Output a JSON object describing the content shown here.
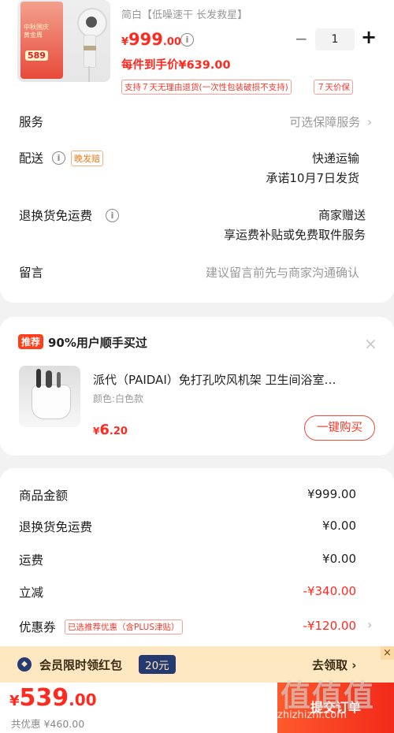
{
  "product": {
    "title": "简白【低噪速干 长发救星】",
    "price_symbol": "¥",
    "price_int": "999",
    "price_dec": ".00",
    "info_glyph": "i",
    "unit_price": "每件到手价¥639.00",
    "tag_return": "支持７天无理由退货(一次性包装破损不支持)",
    "tag_price": "７天价保",
    "poster_lines": [
      "中秋国庆",
      "黄金周"
    ],
    "poster_price": "589",
    "minus_glyph": "−",
    "quantity": "1",
    "plus_glyph": "+"
  },
  "rows": {
    "service": {
      "label": "服务",
      "value": "可选保障服务"
    },
    "delivery": {
      "label": "配送",
      "tag": "晚发赔",
      "line1": "快递运输",
      "line2": "承诺10月7日发货"
    },
    "return_fee": {
      "label": "退换货免运费",
      "line1": "商家赠送",
      "line2": "享运费补贴或免费取件服务"
    },
    "note": {
      "label": "留言",
      "placeholder": "建议留言前先与商家沟通确认"
    }
  },
  "recommend": {
    "badge": "推荐",
    "title": "90%用户顺手买过",
    "item_title": "派代（PAIDAI）免打孔吹风机架 卫生间浴室…",
    "item_spec": "颜色:白色款",
    "item_price_symbol": "¥",
    "item_price_int": "6",
    "item_price_dec": ".20",
    "button": "一键购买",
    "close_glyph": "×"
  },
  "summary": {
    "goods_label": "商品金额",
    "goods_value": "¥999.00",
    "return_label": "退换货免运费",
    "return_value": "¥0.00",
    "ship_label": "运费",
    "ship_value": "¥0.00",
    "discount_label": "立减",
    "discount_value": "-¥340.00",
    "coupon_label": "优惠券",
    "coupon_tag": "已选推荐优惠（含PLUS津贴）",
    "coupon_value": "-¥120.00"
  },
  "vip": {
    "text": "会员限时领红包",
    "amount": "20元",
    "action": "去领取 ›",
    "close_glyph": "×"
  },
  "footer": {
    "total_symbol": "¥",
    "total_int": "539",
    "total_dec": ".00",
    "saved": "共优惠 ¥460.00",
    "submit": "提交订单"
  },
  "watermark": {
    "text": "值值值",
    "url": "zhizhizhi.com"
  },
  "icons": {
    "chevron": "chevron-right-icon",
    "info": "info-icon",
    "close": "close-icon"
  },
  "colors": {
    "accent_red": "#ff2a1f",
    "vip_bg": "#fde8c2",
    "vip_chip": "#243a70"
  }
}
